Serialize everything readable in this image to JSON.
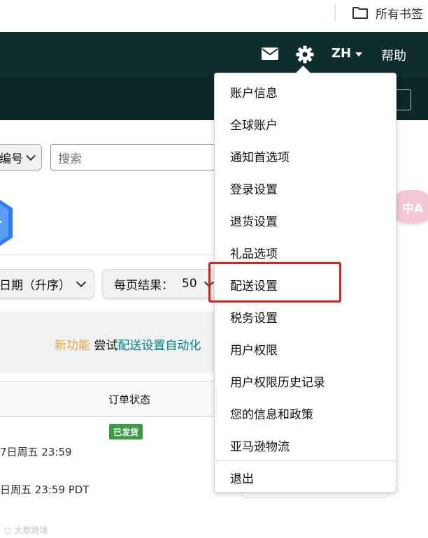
{
  "browser": {
    "bookmarks_label": "所有书签"
  },
  "header": {
    "language": "ZH",
    "help": "帮助"
  },
  "filters": {
    "field_select_label": "编号",
    "search_placeholder": "搜索",
    "sort_label": "日期（升序）",
    "per_page_label": "每页结果：",
    "per_page_value": "50"
  },
  "banner": {
    "new_label": "新功能",
    "try_label": "尝试",
    "link_text": "配送设置自动化"
  },
  "table": {
    "column_status": "订单状态",
    "status_badge": "已发货",
    "row1_date": "7日周五 23:59",
    "row2_date": "日周五 23:59 PDT"
  },
  "translate": {
    "label": "中A"
  },
  "menu": {
    "items": [
      "账户信息",
      "全球账户",
      "通知首选项",
      "登录设置",
      "退货设置",
      "礼品选项",
      "配送设置",
      "税务设置",
      "用户权限",
      "用户权限历史记录",
      "您的信息和政策",
      "亚马逊物流",
      "退出"
    ],
    "highlighted_index": 6
  },
  "colors": {
    "header_bg": "#0f2d2f",
    "highlight": "#e0211b",
    "new_feature": "#e9a63b",
    "link": "#00818a",
    "badge_green": "#3a9d46"
  },
  "watermark": "大数跨境"
}
